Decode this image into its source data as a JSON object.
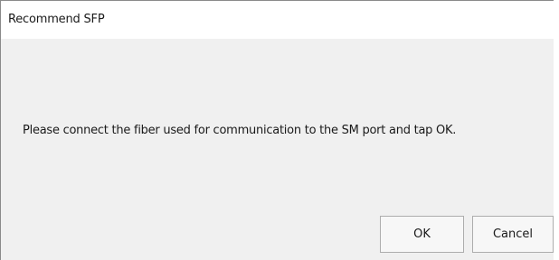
{
  "window": {
    "title": "Recommend SFP"
  },
  "dialog": {
    "message": "Please connect the fiber used for communication to the SM port and tap OK.",
    "ok_label": "OK",
    "cancel_label": "Cancel"
  }
}
